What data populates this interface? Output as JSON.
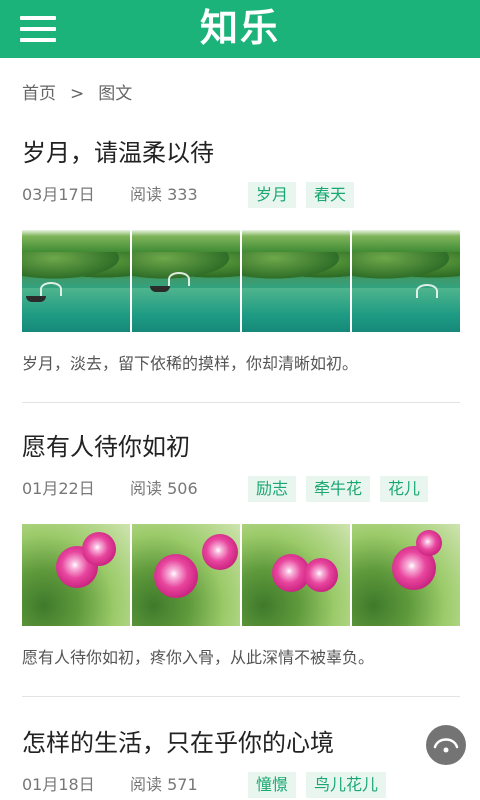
{
  "header": {
    "title": "知乐",
    "menu_icon": "hamburger-menu-icon"
  },
  "breadcrumb": {
    "home": "首页",
    "separator": ">",
    "current": "图文"
  },
  "articles": [
    {
      "title": "岁月，请温柔以待",
      "date": "03月17日",
      "reads": "阅读 333",
      "tags": [
        "岁月",
        "春天"
      ],
      "excerpt": "岁月，淡去，留下依稀的摸样，你却清晰如初。"
    },
    {
      "title": "愿有人待你如初",
      "date": "01月22日",
      "reads": "阅读 506",
      "tags": [
        "励志",
        "牵牛花",
        "花儿"
      ],
      "excerpt": "愿有人待你如初，疼你入骨，从此深情不被辜负。"
    },
    {
      "title": "怎样的生活，只在乎你的心境",
      "date": "01月18日",
      "reads": "阅读 571",
      "tags": [
        "憧憬",
        "鸟儿花儿"
      ]
    }
  ],
  "colors": {
    "brand": "#1bb37a",
    "tag_bg": "#e8f6ef",
    "tag_text": "#1aa870"
  },
  "fab": {
    "icon": "scroll-top-icon"
  }
}
